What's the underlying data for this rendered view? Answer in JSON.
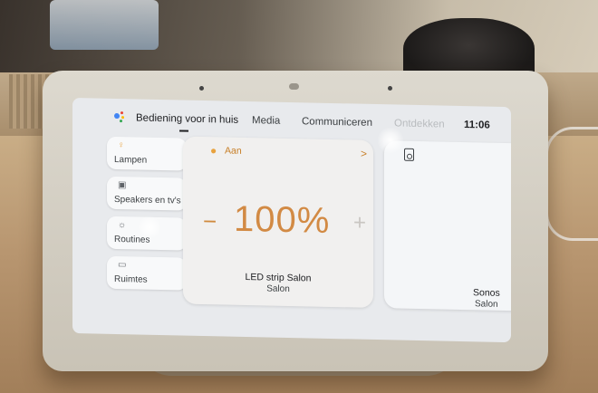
{
  "nav": {
    "tabs": [
      {
        "label": "Bediening voor in huis"
      },
      {
        "label": "Media"
      },
      {
        "label": "Communiceren"
      },
      {
        "label": "Ontdekken"
      }
    ],
    "time": "11:06"
  },
  "sidebar": {
    "items": [
      {
        "label": "Lampen",
        "icon": "bulb-icon"
      },
      {
        "label": "Speakers en tv's",
        "icon": "tv-icon"
      },
      {
        "label": "Routines",
        "icon": "sun-icon"
      },
      {
        "label": "Ruimtes",
        "icon": "bed-icon"
      }
    ]
  },
  "light_card": {
    "state": "Aan",
    "chevron": ">",
    "brightness": "100%",
    "minus": "−",
    "plus": "+",
    "device_name": "LED strip Salon",
    "room": "Salon",
    "accent_color": "#d28a44"
  },
  "speaker_card": {
    "icon": "speaker-icon",
    "device_name": "Sonos",
    "room": "Salon"
  }
}
